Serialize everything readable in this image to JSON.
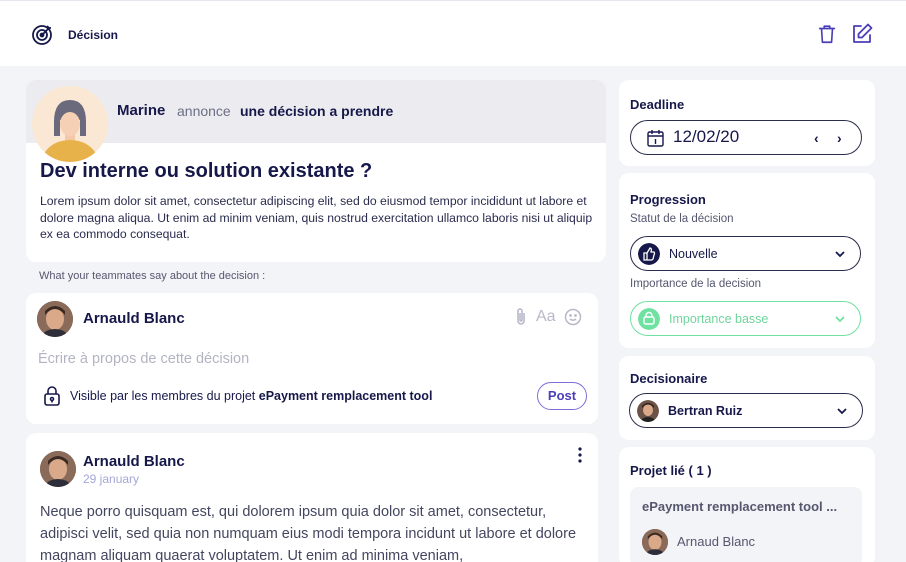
{
  "topbar": {
    "title": "Décision",
    "logo_icon": "target-icon",
    "delete_icon": "trash-icon",
    "edit_icon": "edit-icon"
  },
  "announcement": {
    "author": "Marine",
    "verb": "annonce",
    "what": "une décision a prendre",
    "title": "Dev interne ou solution existante ?",
    "description": "Lorem ipsum dolor sit amet, consectetur adipiscing elit, sed do eiusmod tempor incididunt ut labore et dolore magna aliqua. Ut enim ad minim veniam, quis nostrud exercitation ullamco laboris nisi ut aliquip ex ea commodo consequat."
  },
  "teammates_label": "What your teammates say about the decision :",
  "composer": {
    "author": "Arnauld Blanc",
    "placeholder": "Écrire à propos de cette décision",
    "format_label": "Aa",
    "visibility_prefix": "Visible par les membres du projet ",
    "visibility_project": "ePayment remplacement tool",
    "post_label": "Post"
  },
  "comment": {
    "author": "Arnauld Blanc",
    "date": "29 january",
    "text": "Neque porro quisquam est, qui dolorem ipsum quia dolor sit amet, consectetur, adipisci velit, sed quia non numquam eius modi tempora incidunt ut labore et dolore magnam aliquam quaerat voluptatem. Ut enim ad minima veniam,"
  },
  "deadline": {
    "title": "Deadline",
    "date": "12/02/20"
  },
  "progression": {
    "title": "Progression",
    "status_label": "Statut de la décision",
    "status_value": "Nouvelle",
    "importance_label": "Importance de la decision",
    "importance_value": "Importance basse",
    "importance_color": "#6fe1a0"
  },
  "decisionnaire": {
    "title": "Decisionaire",
    "value": "Bertran Ruiz"
  },
  "projet": {
    "title": "Projet lié ( 1 )",
    "name": "ePayment remplacement tool ...",
    "member": "Arnaud Blanc"
  }
}
